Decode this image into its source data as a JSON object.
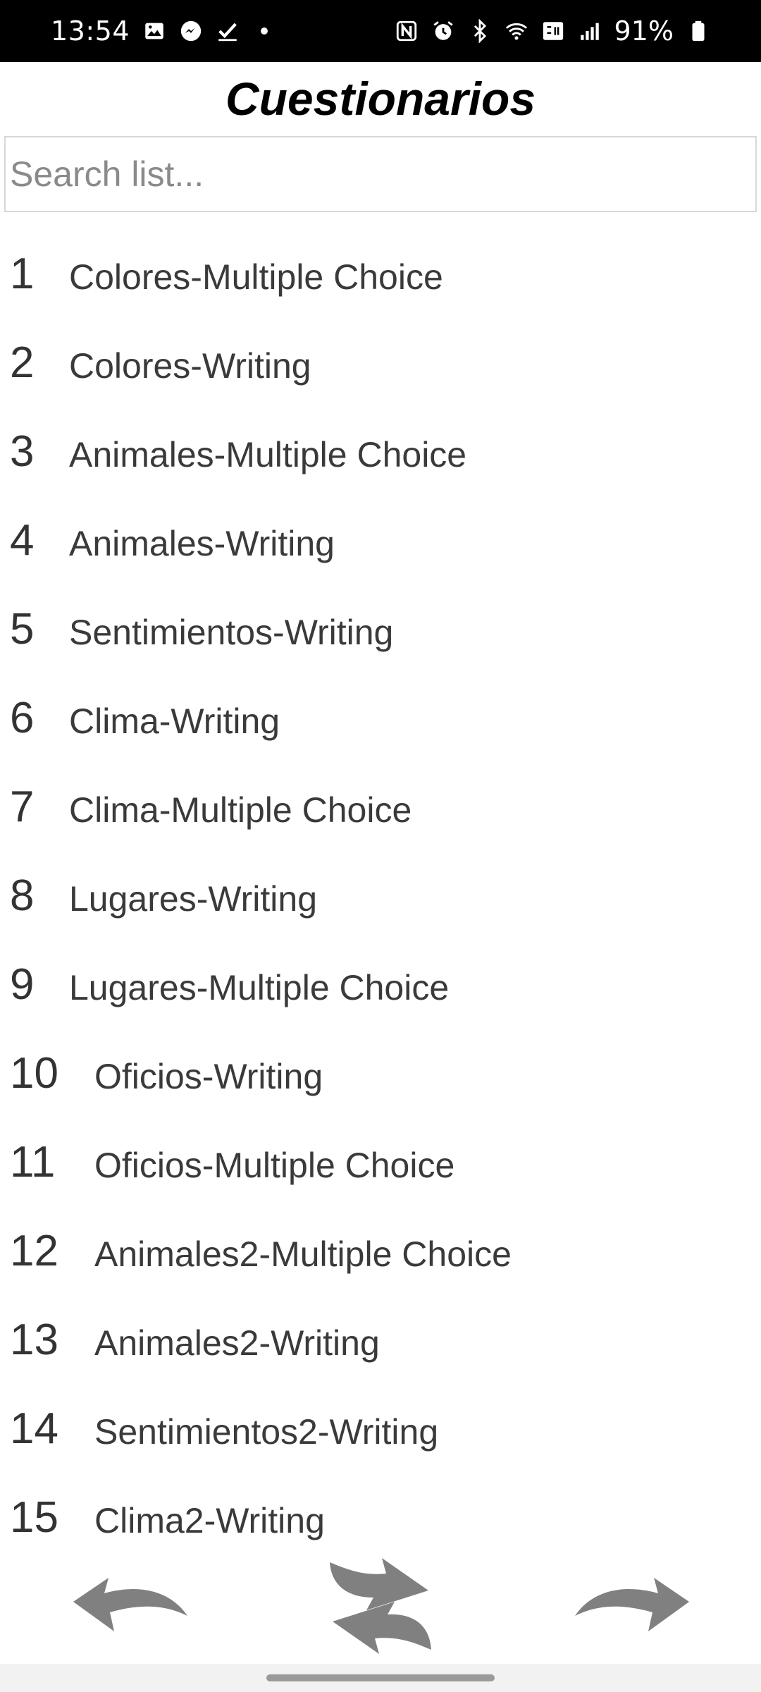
{
  "status_bar": {
    "time": "13:54",
    "battery_text": "91%",
    "left_icons": [
      "image-icon",
      "messenger-icon",
      "check-icon",
      "dot-icon"
    ],
    "right_icons": [
      "nfc-icon",
      "alarm-icon",
      "bluetooth-icon",
      "wifi-icon",
      "volte-icon",
      "signal-icon",
      "battery-icon"
    ]
  },
  "header": {
    "title": "Cuestionarios"
  },
  "search": {
    "placeholder": "Search list...",
    "value": ""
  },
  "quizzes": [
    {
      "number": "1",
      "label": "Colores-Multiple Choice"
    },
    {
      "number": "2",
      "label": "Colores-Writing"
    },
    {
      "number": "3",
      "label": "Animales-Multiple Choice"
    },
    {
      "number": "4",
      "label": "Animales-Writing"
    },
    {
      "number": "5",
      "label": "Sentimientos-Writing"
    },
    {
      "number": "6",
      "label": "Clima-Writing"
    },
    {
      "number": "7",
      "label": "Clima-Multiple Choice"
    },
    {
      "number": "8",
      "label": "Lugares-Writing"
    },
    {
      "number": "9",
      "label": "Lugares-Multiple Choice"
    },
    {
      "number": "10",
      "label": "Oficios-Writing"
    },
    {
      "number": "11",
      "label": "Oficios-Multiple Choice"
    },
    {
      "number": "12",
      "label": "Animales2-Multiple Choice"
    },
    {
      "number": "13",
      "label": "Animales2-Writing"
    },
    {
      "number": "14",
      "label": "Sentimientos2-Writing"
    },
    {
      "number": "15",
      "label": "Clima2-Writing"
    }
  ],
  "bottom_nav": {
    "back_icon": "back-arrow-icon",
    "refresh_icon": "refresh-icon",
    "forward_icon": "forward-arrow-icon",
    "icon_color": "#808080"
  },
  "colors": {
    "status_bar_bg": "#000000",
    "text_primary": "#333333",
    "title": "#000000"
  }
}
